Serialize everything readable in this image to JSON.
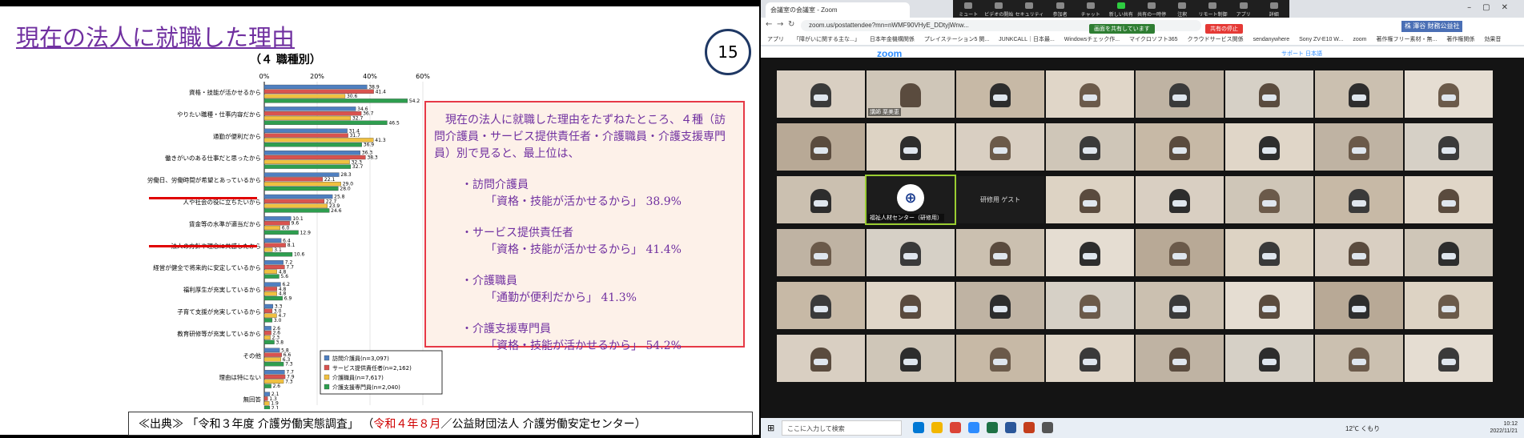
{
  "slide": {
    "title": "現在の法人に就職した理由",
    "page_number": "15",
    "subtitle": "（４ 職種別）",
    "callout": {
      "intro": "現在の法人に就職した理由をたずねたところ、４種（訪問介護員・サービス提供責任者・介護職員・介護支援専門員）別で見ると、最上位は、",
      "items": [
        {
          "label": "・訪問介護員",
          "value": "「資格・技能が活かせるから」 38.9%"
        },
        {
          "label": "・サービス提供責任者",
          "value": "「資格・技能が活かせるから」 41.4%"
        },
        {
          "label": "・介護職員",
          "value": "「通勤が便利だから」 41.3%"
        },
        {
          "label": "・介護支援専門員",
          "value": "「資格・技能が活かせるから」 54.2%"
        }
      ]
    },
    "source": {
      "prefix": "≪出典≫ 「令和３年度 介護労働実態調査」 （",
      "date": "令和４年８月",
      "suffix": "／公益財団法人 介護労働安定センター）"
    }
  },
  "chart_data": {
    "type": "bar",
    "orientation": "horizontal",
    "title": "（４ 職種別）",
    "xlim": [
      0,
      60
    ],
    "xticks": [
      "0%",
      "20%",
      "40%",
      "60%"
    ],
    "categories": [
      "資格・技能が活かせるから",
      "やりたい職種・仕事内容だから",
      "通勤が便利だから",
      "働きがいのある仕事だと思ったから",
      "労働日、労働時間が希望とあっているから",
      "人や社会の役に立ちたいから",
      "賃金等の水準が適当だから",
      "法人の方針や理念に共感したから",
      "経営が健全で将来的に安定しているから",
      "福利厚生が充実しているから",
      "子育て支援が充実しているから",
      "教育研修等が充実しているから",
      "その他",
      "理由は特にない",
      "無回答"
    ],
    "series": [
      {
        "name": "訪問介護員(n=3,097)",
        "color": "#4f7fc0",
        "values": [
          38.9,
          34.6,
          31.4,
          36.3,
          28.3,
          25.8,
          10.1,
          6.4,
          7.2,
          6.2,
          3.3,
          2.6,
          5.8,
          7.7,
          2.1
        ]
      },
      {
        "name": "サービス提供責任者(n=2,162)",
        "color": "#d9534f",
        "values": [
          41.4,
          36.7,
          31.7,
          38.3,
          22.1,
          22.7,
          9.6,
          8.1,
          7.7,
          4.8,
          3.0,
          2.6,
          6.6,
          7.9,
          1.3
        ]
      },
      {
        "name": "介護職員(n=7,617)",
        "color": "#f0c040",
        "values": [
          30.6,
          32.7,
          41.3,
          32.3,
          29.0,
          23.9,
          6.0,
          3.1,
          4.8,
          4.8,
          4.7,
          2.3,
          6.3,
          7.3,
          1.9
        ]
      },
      {
        "name": "介護支援専門員(n=2,040)",
        "color": "#2e9e4f",
        "values": [
          54.2,
          46.5,
          36.9,
          32.7,
          28.0,
          24.6,
          12.9,
          10.6,
          5.6,
          6.9,
          3.0,
          3.8,
          7.3,
          2.6,
          2.1
        ]
      }
    ]
  },
  "browser": {
    "tab_title": "会議室の会議室 - Zoom",
    "url": "zoom.us/postattendee?mn=nWMF90VHyE_DDtyjWnw...",
    "bookmarks": [
      "アプリ",
      "「障がいに関する主な...」",
      "日本年金機構関係",
      "プレイステーション5 関...",
      "JUNKCALL｜日本最...",
      "Windowsチェック作...",
      "マイクロソフト365",
      "クラウドサービス関係",
      "sendanywhere",
      "Sony ZV-E10 W...",
      "zoom",
      "著作権フリー素材・無...",
      "著作権関係",
      "効果音"
    ],
    "zoom_toolbar": [
      {
        "label": "ミュート",
        "icon": "mic-icon"
      },
      {
        "label": "ビデオの開始",
        "icon": "video-icon"
      },
      {
        "label": "セキュリティ",
        "icon": "shield-icon"
      },
      {
        "label": "参加者",
        "icon": "participants-icon"
      },
      {
        "label": "チャット",
        "icon": "chat-icon"
      },
      {
        "label": "新しい共有",
        "icon": "share-icon"
      },
      {
        "label": "共有の一時停止",
        "icon": "pause-icon"
      },
      {
        "label": "注釈",
        "icon": "pen-icon"
      },
      {
        "label": "リモート制御",
        "icon": "remote-icon"
      },
      {
        "label": "アプリ",
        "icon": "apps-icon"
      },
      {
        "label": "詳細",
        "icon": "more-icon"
      }
    ],
    "sharing_label": "画面を共有しています",
    "stop_share_label": "共有の停止",
    "org_badge": "株 澤谷\n財務公益社",
    "zoom_logo": "zoom",
    "zoom_links": "サポート  日本語",
    "tile_names": {
      "speaker": "講師 栗美恵",
      "center": "福祉人材センター（研修用）",
      "blank": "研修用 ゲスト"
    },
    "taskbar": {
      "search_placeholder": "ここに入力して検索",
      "weather": "12℃ くもり",
      "time": "10:12",
      "date": "2022/11/21"
    }
  }
}
